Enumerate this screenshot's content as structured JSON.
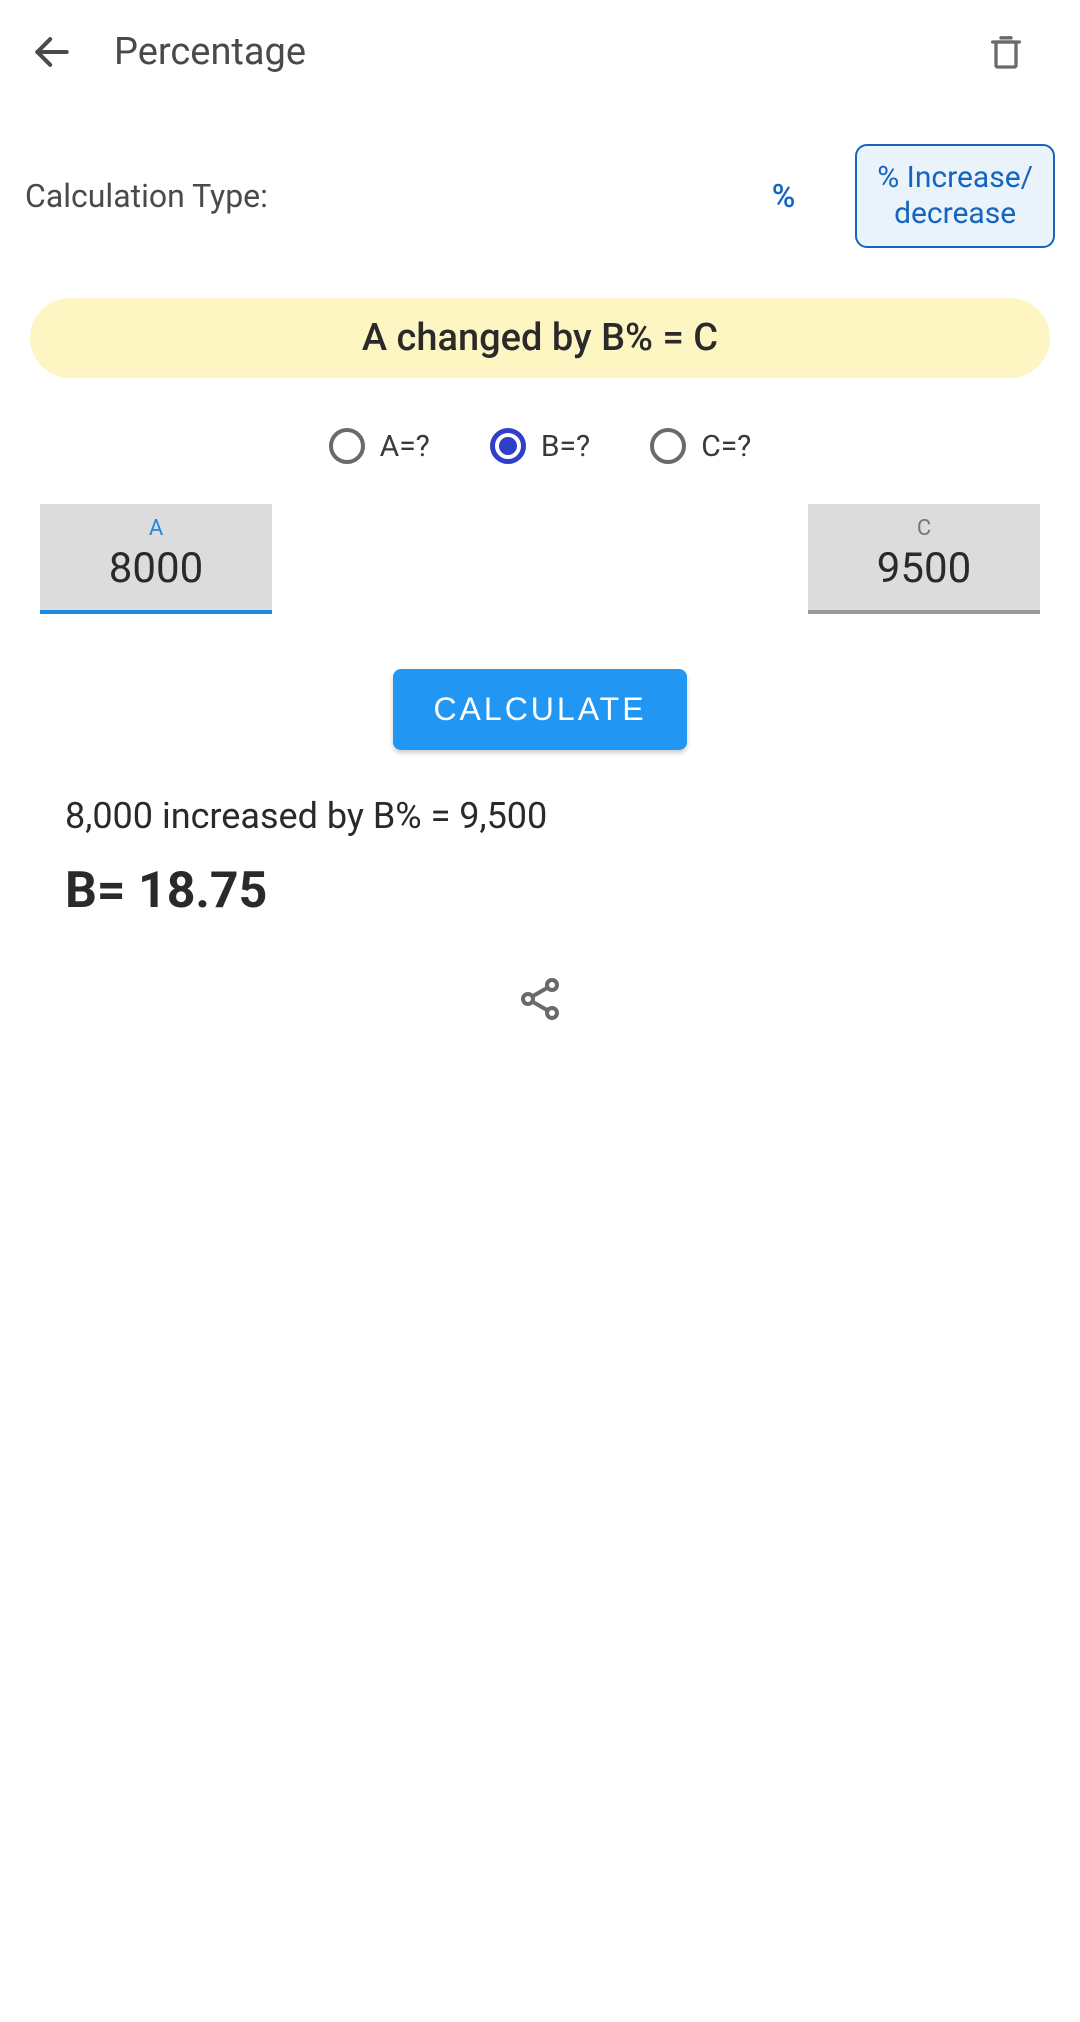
{
  "header": {
    "title": "Percentage"
  },
  "calcType": {
    "label": "Calculation Type:",
    "percentTab": "%",
    "increaseTabLine1": "% Increase/",
    "increaseTabLine2": "decrease"
  },
  "formula": "A changed by B% = C",
  "radios": {
    "a": "A=?",
    "b": "B=?",
    "c": "C=?"
  },
  "inputs": {
    "a": {
      "label": "A",
      "value": "8000"
    },
    "c": {
      "label": "C",
      "value": "9500"
    }
  },
  "calculateLabel": "CALCULATE",
  "result": {
    "statement": "8,000 increased by B% = 9,500",
    "answer": "B= 18.75"
  }
}
